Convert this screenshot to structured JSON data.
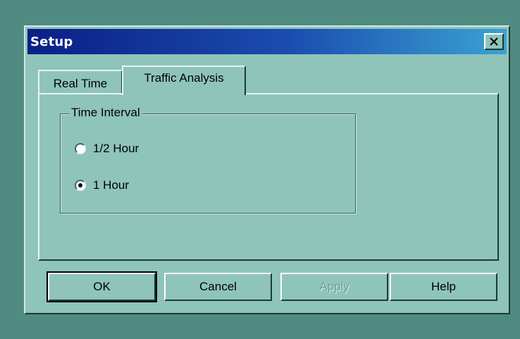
{
  "window": {
    "title": "Setup",
    "close_label": "×"
  },
  "tabs": [
    {
      "label": "Real Time",
      "selected": false
    },
    {
      "label": "Traffic Analysis",
      "selected": true
    }
  ],
  "group": {
    "title": "Time Interval",
    "options": [
      {
        "label": "1/2 Hour",
        "checked": false
      },
      {
        "label": "1 Hour",
        "checked": true
      }
    ]
  },
  "buttons": {
    "ok": "OK",
    "cancel": "Cancel",
    "apply": "Apply",
    "help": "Help"
  },
  "colors": {
    "desktop": "#4f8b80",
    "face": "#8fc4bb",
    "title_start": "#0a1f86",
    "title_end": "#3aa3d2"
  }
}
